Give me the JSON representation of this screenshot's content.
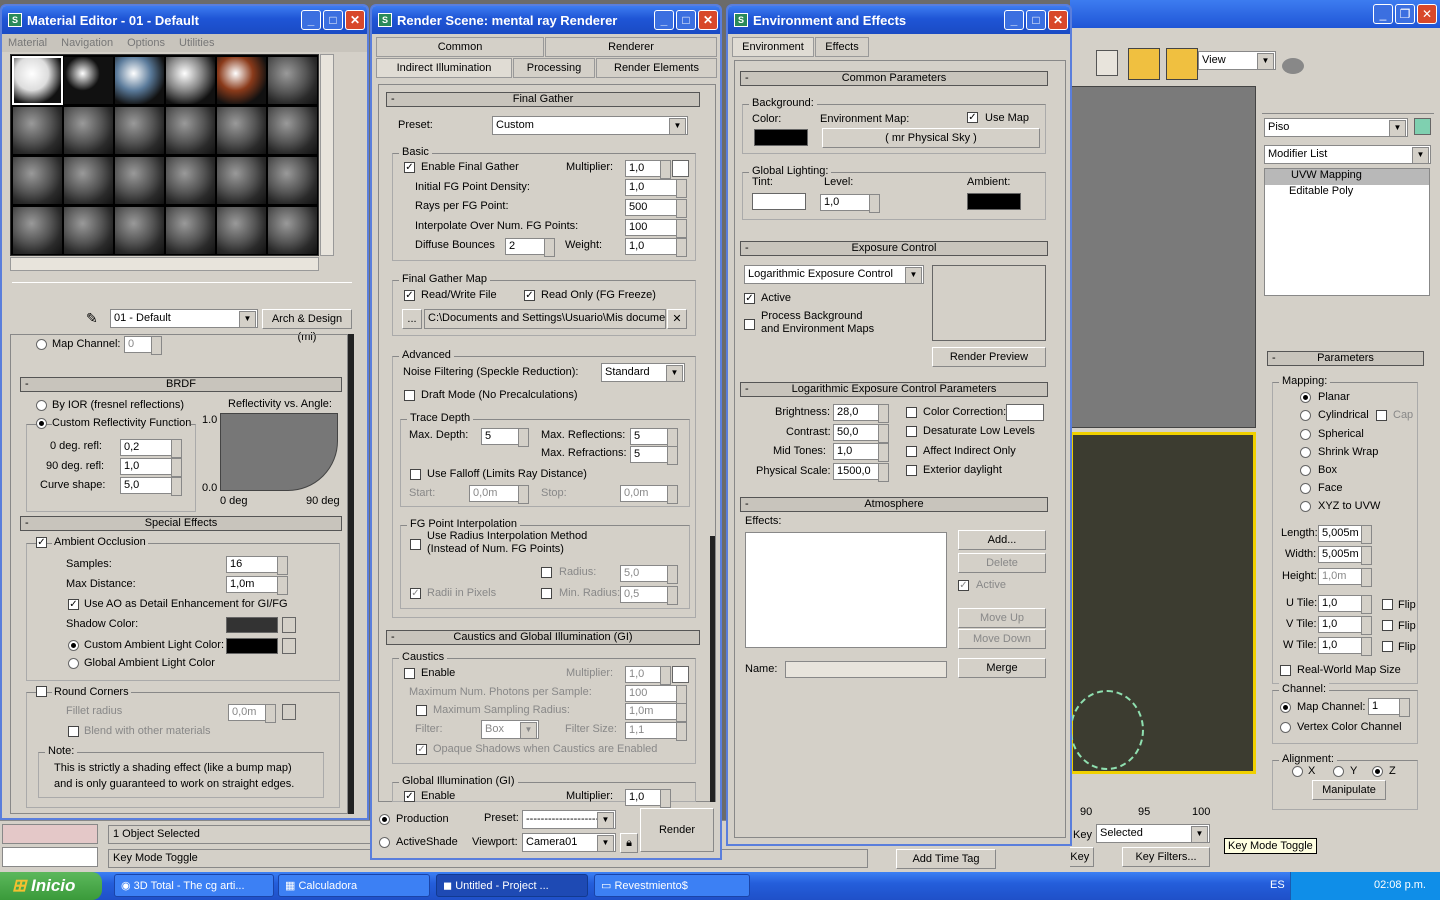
{
  "viewport_bg": {
    "labels": [
      "90",
      "95",
      "100"
    ]
  },
  "main_toolbar": {
    "view": "View"
  },
  "cmd_panel": {
    "object_name": "Piso",
    "modifier_list": "Modifier List",
    "stack": [
      "UVW Mapping",
      "Editable Poly"
    ],
    "params_title": "Parameters",
    "mapping_label": "Mapping:",
    "mapping": [
      "Planar",
      "Cylindrical",
      "Spherical",
      "Shrink Wrap",
      "Box",
      "Face",
      "XYZ to UVW"
    ],
    "cap": "Cap",
    "length_l": "Length:",
    "length": "5,005m",
    "width_l": "Width:",
    "width": "5,005m",
    "height_l": "Height:",
    "height": "1,0m",
    "utile_l": "U Tile:",
    "utile": "1,0",
    "vtile_l": "V Tile:",
    "vtile": "1,0",
    "wtile_l": "W Tile:",
    "wtile": "1,0",
    "flip": "Flip",
    "realworld": "Real-World Map Size",
    "channel_label": "Channel:",
    "map_channel": "Map Channel:",
    "map_channel_v": "1",
    "vertex_color": "Vertex Color Channel",
    "alignment_label": "Alignment:",
    "x": "X",
    "y": "Y",
    "z": "Z",
    "manipulate": "Manipulate"
  },
  "anim": {
    "key": "Key",
    "selected": "Selected",
    "set_key": "Set Key",
    "key_filters": "Key Filters...",
    "tooltip": "Key Mode Toggle",
    "add_time_tag": "Add Time Tag"
  },
  "status": {
    "selected": "1 Object Selected",
    "mode": "Key Mode Toggle"
  },
  "mat": {
    "title": "Material Editor - 01 - Default",
    "menu": [
      "Material",
      "Navigation",
      "Options",
      "Utilities"
    ],
    "name": "01 - Default",
    "type": "Arch & Design (mi)",
    "map_channel": "Map Channel:",
    "map_channel_v": "0",
    "brdf": "BRDF",
    "by_ior": "By IOR (fresnel reflections)",
    "custom_refl": "Custom Reflectivity Function",
    "refl_vs_angle": "Reflectivity vs. Angle:",
    "deg0_l": "0 deg. refl:",
    "deg0": "0,2",
    "deg90_l": "90 deg. refl:",
    "deg90": "1,0",
    "curve_l": "Curve shape:",
    "curve": "5,0",
    "y1": "1.0",
    "y0": "0.0",
    "x0": "0 deg",
    "x90": "90 deg",
    "special": "Special Effects",
    "ao": "Ambient Occlusion",
    "samples_l": "Samples:",
    "samples": "16",
    "maxdist_l": "Max Distance:",
    "maxdist": "1,0m",
    "use_ao": "Use AO as Detail Enhancement for GI/FG",
    "shadow_color": "Shadow Color:",
    "custom_amb": "Custom Ambient Light Color:",
    "global_amb": "Global Ambient Light Color",
    "round": "Round Corners",
    "fillet_l": "Fillet radius",
    "fillet": "0,0m",
    "blend": "Blend with other materials",
    "note_l": "Note:",
    "note1": "This is strictly a shading effect (like a bump map)",
    "note2": "and is only guaranteed to work on straight edges."
  },
  "rs": {
    "title": "Render Scene: mental ray Renderer",
    "tabs_top": [
      "Common",
      "Renderer"
    ],
    "tabs_bot": [
      "Indirect Illumination",
      "Processing",
      "Render Elements"
    ],
    "fg": "Final Gather",
    "preset_l": "Preset:",
    "preset": "Custom",
    "basic": "Basic",
    "enable_fg": "Enable Final Gather",
    "mult_l": "Multiplier:",
    "mult": "1,0",
    "init_l": "Initial FG Point Density:",
    "init": "1,0",
    "rays_l": "Rays per FG Point:",
    "rays": "500",
    "interp_l": "Interpolate Over Num. FG Points:",
    "interp": "100",
    "bounces_l": "Diffuse Bounces",
    "bounces": "2",
    "weight_l": "Weight:",
    "weight": "1,0",
    "fgmap": "Final Gather Map",
    "rw": "Read/Write File",
    "ro": "Read Only (FG Freeze)",
    "path": "C:\\Documents and Settings\\Usuario\\Mis documer",
    "advanced": "Advanced",
    "noise_l": "Noise Filtering (Speckle Reduction):",
    "noise": "Standard",
    "draft": "Draft Mode (No Precalculations)",
    "trace": "Trace Depth",
    "maxdepth_l": "Max. Depth:",
    "maxdepth": "5",
    "maxrefl_l": "Max. Reflections:",
    "maxrefl": "5",
    "maxrefr_l": "Max. Refractions:",
    "maxrefr": "5",
    "falloff": "Use Falloff (Limits Ray Distance)",
    "start_l": "Start:",
    "start": "0,0m",
    "stop_l": "Stop:",
    "stop": "0,0m",
    "fgpi": "FG Point Interpolation",
    "radius_method1": "Use Radius Interpolation Method",
    "radius_method2": "(Instead of Num. FG Points)",
    "radius_l": "Radius:",
    "radius": "5,0",
    "radii_px": "Radii in Pixels",
    "minradius_l": "Min. Radius:",
    "minradius": "0,5",
    "caustics_gi": "Caustics and Global Illumination (GI)",
    "caustics": "Caustics",
    "enable": "Enable",
    "cmult": "1,0",
    "maxphot_l": "Maximum Num. Photons per Sample:",
    "maxphot": "100",
    "maxsamp_l": "Maximum Sampling Radius:",
    "maxsamp": "1,0m",
    "filter_l": "Filter:",
    "filter": "Box",
    "filtersize_l": "Filter Size:",
    "filtersize": "1,1",
    "opaque": "Opaque Shadows when Caustics are Enabled",
    "gi": "Global Illumination (GI)",
    "gmult": "1,0",
    "production": "Production",
    "activeshade": "ActiveShade",
    "preset2_l": "Preset:",
    "preset2": "--------------------",
    "viewport_l": "Viewport:",
    "viewport": "Camera01",
    "render": "Render"
  },
  "env": {
    "title": "Environment and Effects",
    "tabs": [
      "Environment",
      "Effects"
    ],
    "common": "Common Parameters",
    "background": "Background:",
    "color_l": "Color:",
    "envmap_l": "Environment Map:",
    "usemap": "Use Map",
    "mapname": "( mr Physical Sky )",
    "global_light": "Global Lighting:",
    "tint_l": "Tint:",
    "level_l": "Level:",
    "level": "1,0",
    "ambient_l": "Ambient:",
    "exposure": "Exposure Control",
    "exp_type": "Logarithmic Exposure Control",
    "active": "Active",
    "process1": "Process Background",
    "process2": "and Environment Maps",
    "render_preview": "Render Preview",
    "log_params": "Logarithmic Exposure Control Parameters",
    "bright_l": "Brightness:",
    "bright": "28,0",
    "contrast_l": "Contrast:",
    "contrast": "50,0",
    "mid_l": "Mid Tones:",
    "mid": "1,0",
    "phys_l": "Physical Scale:",
    "phys": "1500,0",
    "colorcorr": "Color Correction:",
    "desat": "Desaturate Low Levels",
    "affect": "Affect Indirect Only",
    "exterior": "Exterior daylight",
    "atmos": "Atmosphere",
    "effects_l": "Effects:",
    "add": "Add...",
    "delete": "Delete",
    "active2": "Active",
    "moveup": "Move Up",
    "movedown": "Move Down",
    "name_l": "Name:",
    "merge": "Merge"
  },
  "taskbar": {
    "start": "Inicio",
    "items": [
      "3D Total - The cg arti...",
      "Calculadora",
      "Untitled     - Project ...",
      "Revestmiento$"
    ],
    "lang": "ES",
    "time": "02:08 p.m."
  },
  "colors": {
    "title": "#1f55d6",
    "task": "#245edb",
    "start": "#3a9a3a"
  }
}
